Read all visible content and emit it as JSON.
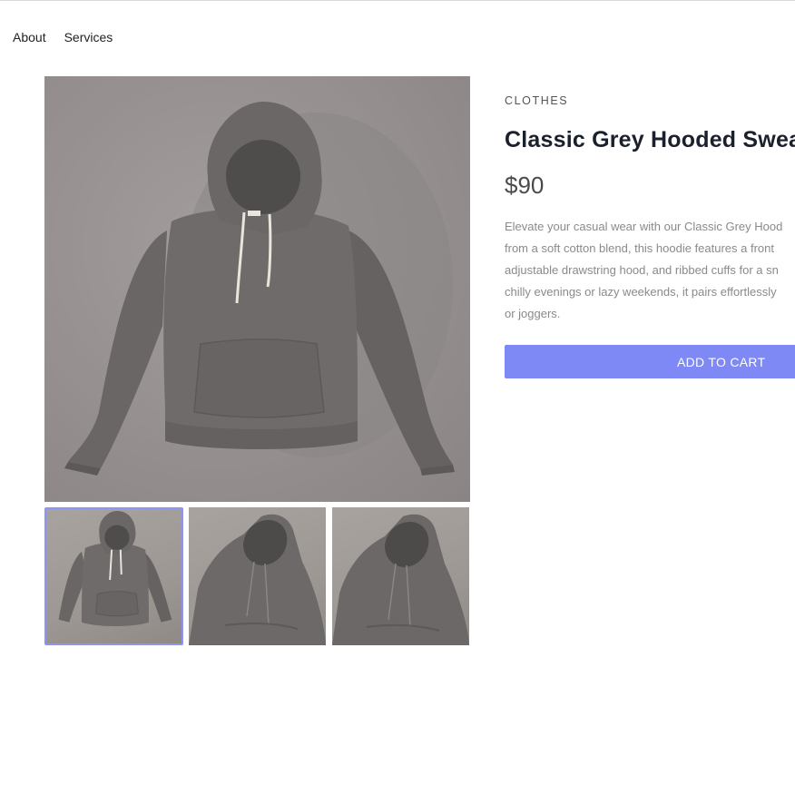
{
  "nav": {
    "about": "About",
    "services": "Services"
  },
  "product": {
    "category": "CLOTHES",
    "title": "Classic Grey Hooded Swea",
    "price": "$90",
    "description": "Elevate your casual wear with our Classic Grey Hood\nfrom a soft cotton blend, this hoodie features a front\nadjustable drawstring hood, and ribbed cuffs for a sn\nchilly evenings or lazy weekends, it pairs effortlessly\nor joggers.",
    "add_to_cart_label": "ADD TO CART"
  },
  "gallery": {
    "selected_index": 0,
    "images": [
      "hoodie-front",
      "hoodie-hood-closeup",
      "hoodie-hood-closeup"
    ]
  },
  "colors": {
    "accent": "#7f89f6",
    "thumb_border": "#8e94f2",
    "hoodie": "#6f6b6b"
  }
}
